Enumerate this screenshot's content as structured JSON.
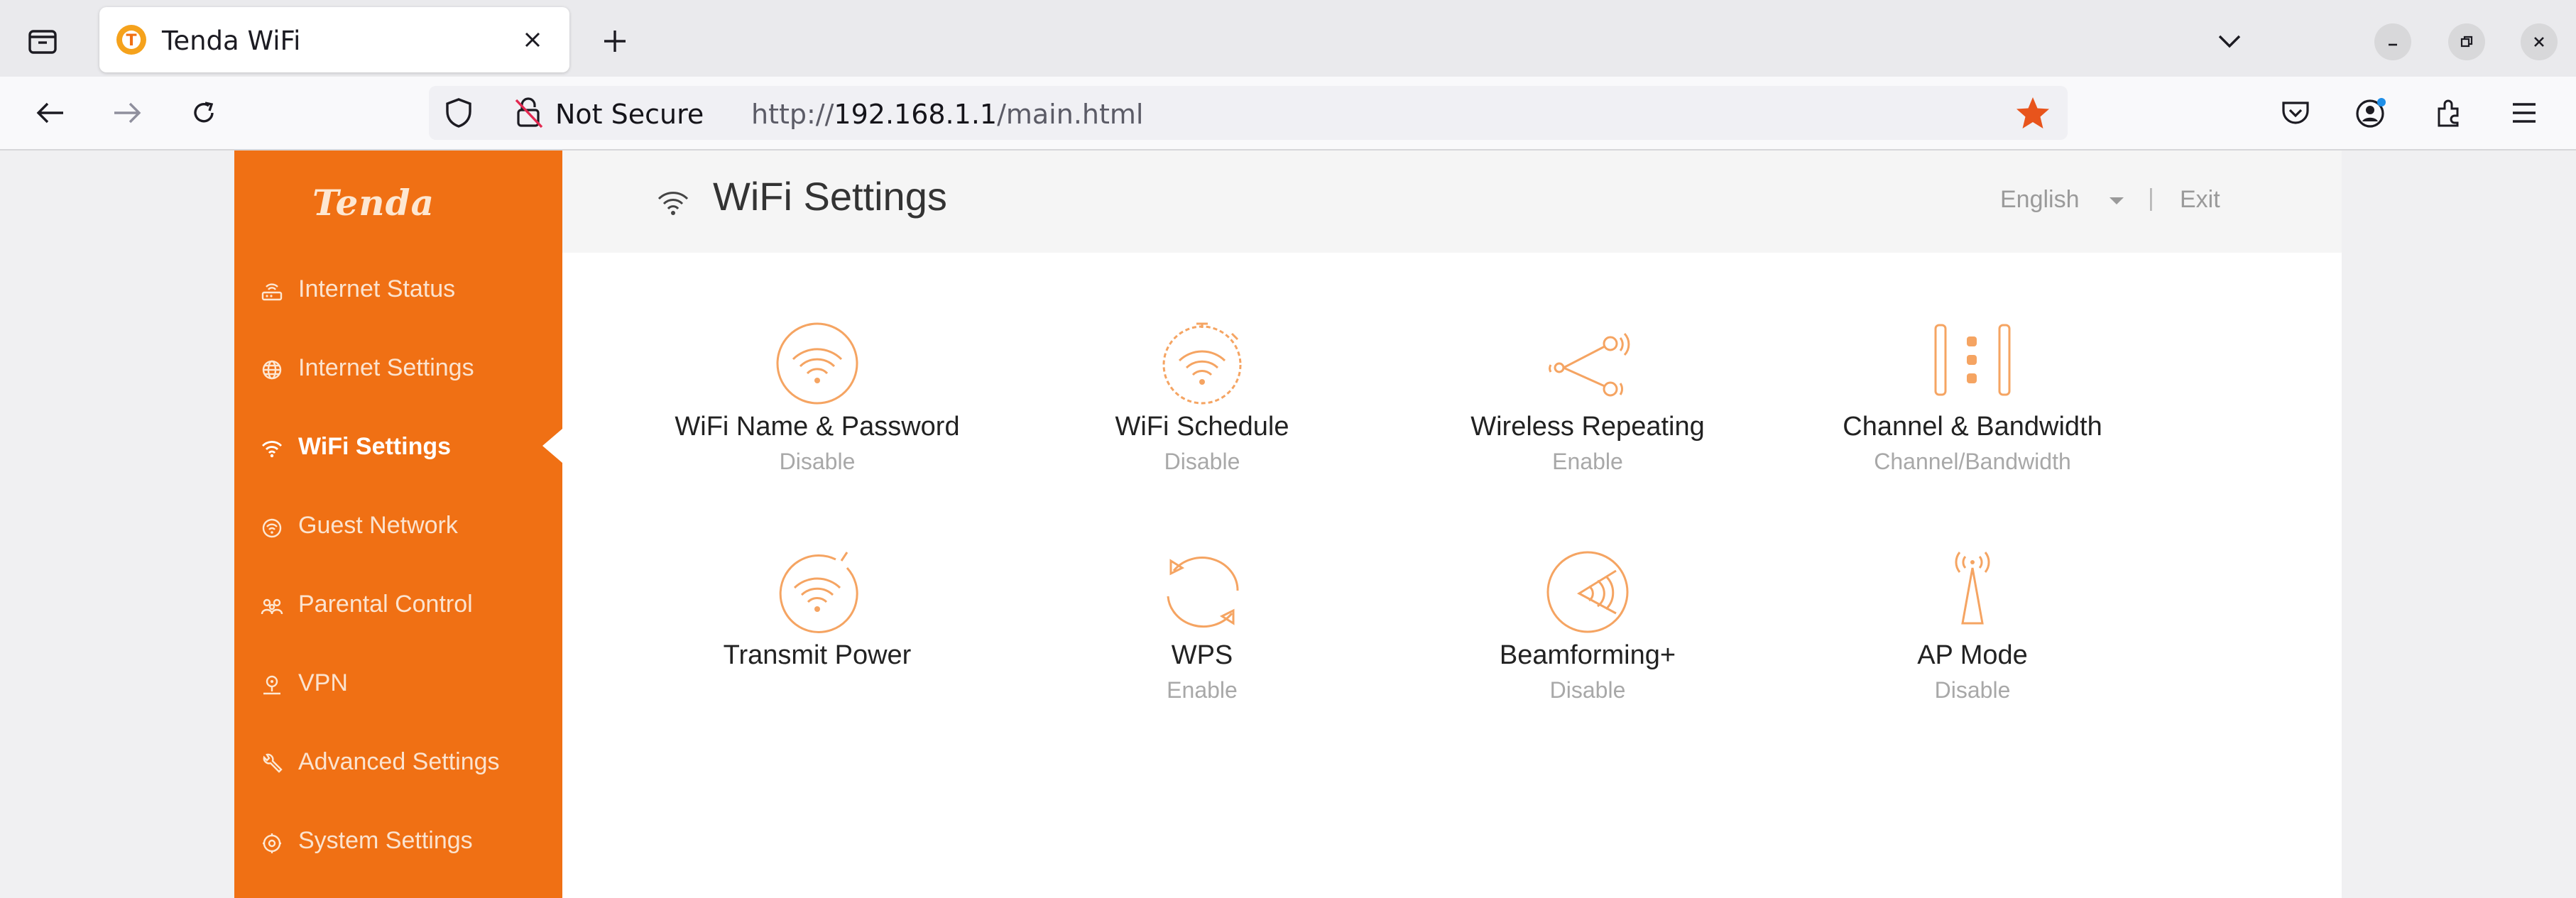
{
  "browser": {
    "tab_title": "Tenda WiFi",
    "security_label": "Not Secure",
    "url_scheme": "http://",
    "url_host": "192.168.1.1",
    "url_path": "/main.html"
  },
  "sidebar": {
    "logo": "Tenda",
    "items": [
      {
        "label": "Internet Status",
        "icon": "router-icon",
        "active": false
      },
      {
        "label": "Internet Settings",
        "icon": "globe-icon",
        "active": false
      },
      {
        "label": "WiFi Settings",
        "icon": "wifi-icon",
        "active": true
      },
      {
        "label": "Guest Network",
        "icon": "guest-wifi-icon",
        "active": false
      },
      {
        "label": "Parental Control",
        "icon": "family-icon",
        "active": false
      },
      {
        "label": "VPN",
        "icon": "vpn-icon",
        "active": false
      },
      {
        "label": "Advanced Settings",
        "icon": "wrench-icon",
        "active": false
      },
      {
        "label": "System Settings",
        "icon": "gear-icon",
        "active": false
      }
    ]
  },
  "header": {
    "title": "WiFi Settings",
    "language": "English",
    "separator": "|",
    "exit": "Exit"
  },
  "tiles": [
    {
      "name": "WiFi Name & Password",
      "status": "Disable",
      "icon": "wifi-circle-icon"
    },
    {
      "name": "WiFi Schedule",
      "status": "Disable",
      "icon": "wifi-timer-icon"
    },
    {
      "name": "Wireless Repeating",
      "status": "Enable",
      "icon": "repeater-icon"
    },
    {
      "name": "Channel & Bandwidth",
      "status": "Channel/Bandwidth",
      "icon": "channel-icon"
    },
    {
      "name": "Transmit Power",
      "status": "",
      "icon": "wifi-power-icon"
    },
    {
      "name": "WPS",
      "status": "Enable",
      "icon": "wps-sync-icon"
    },
    {
      "name": "Beamforming+",
      "status": "Disable",
      "icon": "beamforming-icon"
    },
    {
      "name": "AP Mode",
      "status": "Disable",
      "icon": "antenna-icon"
    }
  ],
  "colors": {
    "sidebar": "#f07014",
    "accent_icon": "#f5a462",
    "star": "#e8541c"
  }
}
